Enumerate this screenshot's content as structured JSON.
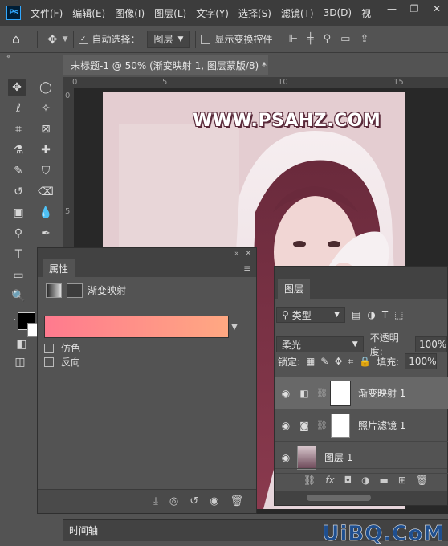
{
  "menu": {
    "logo": "Ps",
    "items": [
      "文件(F)",
      "编辑(E)",
      "图像(I)",
      "图层(L)",
      "文字(Y)",
      "选择(S)",
      "滤镜(T)",
      "3D(D)",
      "视"
    ]
  },
  "window_controls": {
    "minimize": "—",
    "restore": "❐",
    "close": "✕"
  },
  "options_bar": {
    "auto_select_label": "自动选择：",
    "auto_select_target": "图层",
    "show_transform_label": "显示变换控件"
  },
  "document": {
    "tab_title": "未标题-1 @ 50% (渐变映射 1, 图层蒙版/8) *",
    "ruler_h_ticks": [
      "0",
      "5",
      "10",
      "15"
    ],
    "ruler_v_ticks": [
      "0",
      "5"
    ],
    "watermark": "WWW.PSAHZ.COM"
  },
  "properties": {
    "tab": "属性",
    "title": "渐变映射",
    "gradient_colors": [
      "#ff7a8e",
      "#ffa882"
    ],
    "options": [
      {
        "label": "仿色",
        "checked": false
      },
      {
        "label": "反向",
        "checked": false
      }
    ]
  },
  "layers": {
    "tab": "图层",
    "filter_kind": "类型",
    "blend_mode": "柔光",
    "opacity_label": "不透明度:",
    "opacity_value": "100%",
    "lock_label": "锁定:",
    "fill_label": "填充:",
    "fill_value": "100%",
    "items": [
      {
        "name": "渐变映射 1",
        "selected": true
      },
      {
        "name": "照片滤镜 1",
        "selected": false
      },
      {
        "name": "图层 1",
        "selected": false
      }
    ]
  },
  "timeline": {
    "tab": "时间轴"
  },
  "site_watermark": "UiBQ.CoM"
}
